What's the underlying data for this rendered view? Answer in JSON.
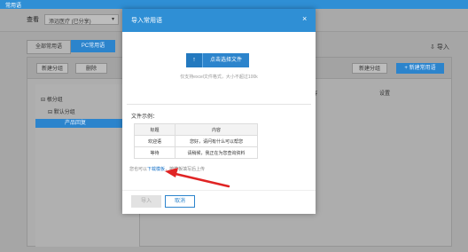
{
  "app": {
    "title": "常用语"
  },
  "filter": {
    "view_label": "查看",
    "selected": "添远医疗 (已分享)"
  },
  "tabs": [
    "全部常用语",
    "PC常用语"
  ],
  "import_top": "导入",
  "toolbar": {
    "new_category": "新建分组",
    "delete": "删除",
    "new_group": "新建分组",
    "new_phrase": "+ 新建常用语"
  },
  "tree": {
    "root": "⊟ 根分组",
    "child": "⊟ 默认分组",
    "selected": "产品回复"
  },
  "columns": {
    "content": "内容",
    "settings": "设置"
  },
  "modal": {
    "title": "导入常用语",
    "close": "×",
    "upload_icon": "↑",
    "upload_label": "点击选择文件",
    "hint": "仅支持excel文件格式，大小不超过100k",
    "format_label": "文件示例：",
    "table": {
      "headers": [
        "标题",
        "内容"
      ],
      "rows": [
        [
          "欢迎语",
          "您好，请问有什么可以帮您"
        ],
        [
          "等待",
          "请稍候，我正在为您查询资料"
        ]
      ]
    },
    "template_prefix": "您也可以",
    "template_link": "下载模板",
    "template_suffix": "，按模板填写后上传",
    "import_button": "导入",
    "cancel_button": "取消"
  },
  "colors": {
    "brand": "#2f8fd5",
    "accent": "#2c84cc",
    "annotation": "#e02424"
  },
  "annotation": {
    "icon": "red-arrow-icon"
  }
}
